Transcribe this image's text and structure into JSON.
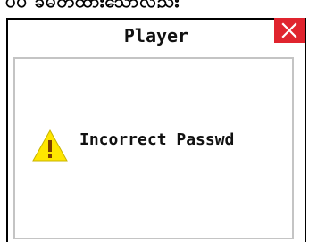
{
  "background_fragment": "ပ်ပ ခ်မှတ်ထားသော်လည်း",
  "dialog": {
    "title": "Player",
    "message": "Incorrect Passwd",
    "close_icon": "close-x-icon",
    "warning_icon": "warning-triangle-icon",
    "colors": {
      "close_bg": "#e0242e",
      "warning_fill": "#ffe600",
      "content_border": "#c4c4c4"
    }
  }
}
